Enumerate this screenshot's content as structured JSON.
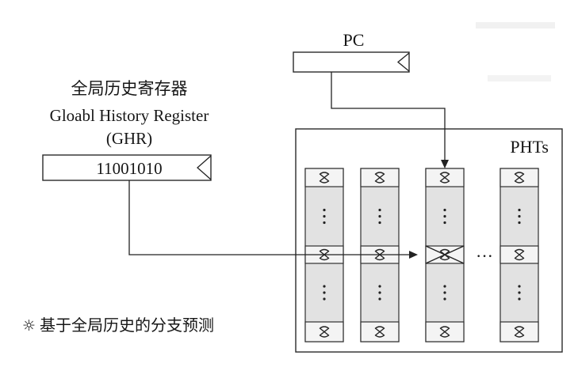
{
  "pc": {
    "label": "PC"
  },
  "ghr": {
    "label_cn": "全局历史寄存器",
    "label_en": "Gloabl History Register",
    "label_abbr": "(GHR)",
    "value": "11001010"
  },
  "pht": {
    "label": "PHTs",
    "ellipsis": "···"
  },
  "caption": {
    "symbol": "☼",
    "text": "基于全局历史的分支预测"
  }
}
